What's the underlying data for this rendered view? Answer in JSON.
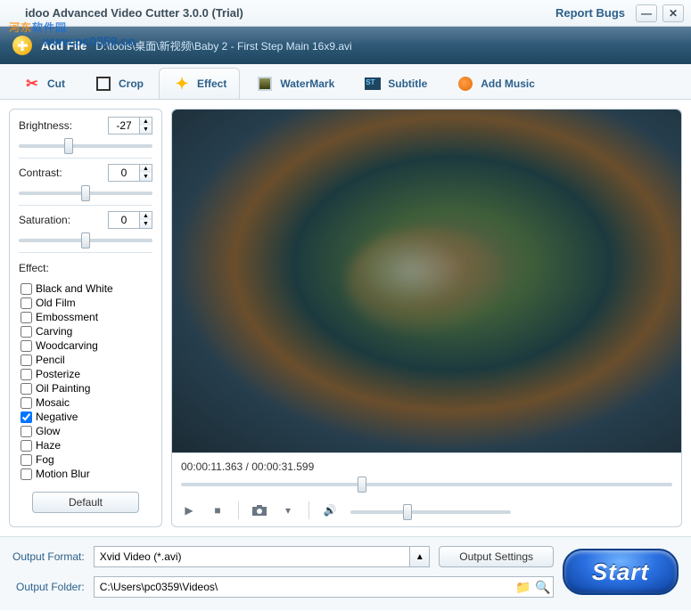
{
  "watermark": {
    "top1": "河东",
    "top2": "软件园",
    "sub": "www.pc0359.cn"
  },
  "titlebar": {
    "title": "idoo Advanced Video Cutter 3.0.0 (Trial)",
    "report": "Report Bugs"
  },
  "filerow": {
    "label": "Add File",
    "path": "D:\\tools\\桌面\\新视频\\Baby 2 - First Step Main 16x9.avi"
  },
  "tabs": {
    "cut": "Cut",
    "crop": "Crop",
    "effect": "Effect",
    "watermark": "WaterMark",
    "subtitle": "Subtitle",
    "addmusic": "Add Music",
    "active": "effect"
  },
  "effect_panel": {
    "brightness": {
      "label": "Brightness:",
      "value": "-27"
    },
    "contrast": {
      "label": "Contrast:",
      "value": "0"
    },
    "saturation": {
      "label": "Saturation:",
      "value": "0"
    },
    "effect_label": "Effect:",
    "items": [
      {
        "label": "Black and White",
        "checked": false
      },
      {
        "label": "Old Film",
        "checked": false
      },
      {
        "label": "Embossment",
        "checked": false
      },
      {
        "label": "Carving",
        "checked": false
      },
      {
        "label": "Woodcarving",
        "checked": false
      },
      {
        "label": "Pencil",
        "checked": false
      },
      {
        "label": "Posterize",
        "checked": false
      },
      {
        "label": "Oil Painting",
        "checked": false
      },
      {
        "label": "Mosaic",
        "checked": false
      },
      {
        "label": "Negative",
        "checked": true
      },
      {
        "label": "Glow",
        "checked": false
      },
      {
        "label": "Haze",
        "checked": false
      },
      {
        "label": "Fog",
        "checked": false
      },
      {
        "label": "Motion Blur",
        "checked": false
      }
    ],
    "default_btn": "Default"
  },
  "preview": {
    "time_current": "00:00:11.363",
    "time_total": "00:00:31.599",
    "time_sep": " / "
  },
  "output": {
    "format_label": "Output Format:",
    "format_value": "Xvid Video (*.avi)",
    "settings_btn": "Output Settings",
    "folder_label": "Output Folder:",
    "folder_value": "C:\\Users\\pc0359\\Videos\\",
    "start_btn": "Start"
  }
}
